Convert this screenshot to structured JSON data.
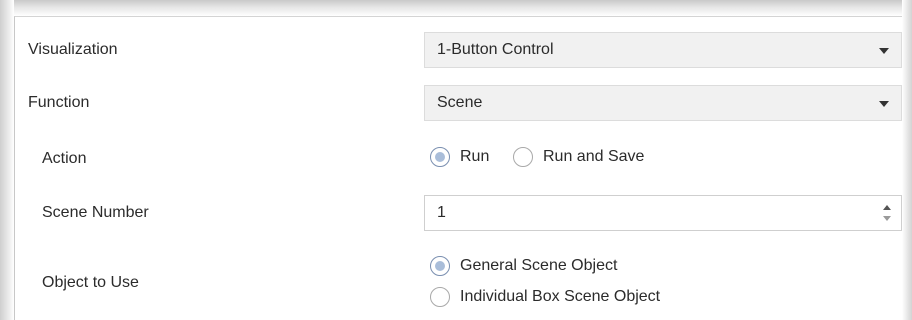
{
  "rows": {
    "visualization": {
      "label": "Visualization",
      "value": "1-Button Control"
    },
    "function": {
      "label": "Function",
      "value": "Scene"
    },
    "action": {
      "label": "Action",
      "options": [
        {
          "label": "Run",
          "selected": true
        },
        {
          "label": "Run and Save",
          "selected": false
        }
      ]
    },
    "scene_number": {
      "label": "Scene Number",
      "value": "1"
    },
    "object_to_use": {
      "label": "Object to Use",
      "options": [
        {
          "label": "General Scene Object",
          "selected": true
        },
        {
          "label": "Individual Box Scene Object",
          "selected": false
        }
      ]
    }
  }
}
